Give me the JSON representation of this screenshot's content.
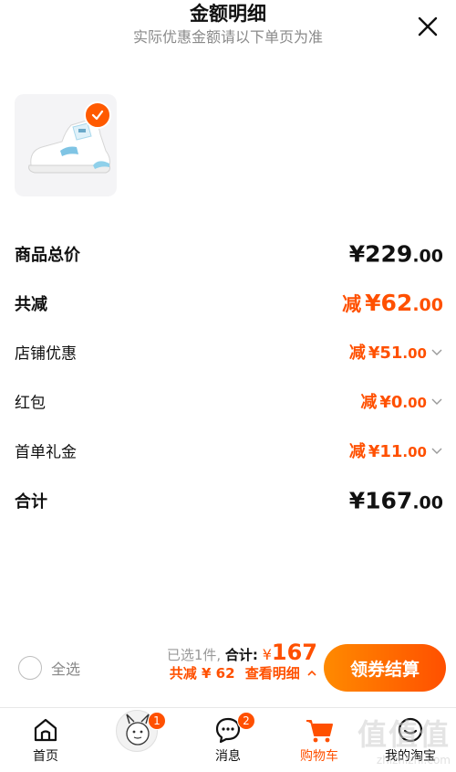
{
  "header": {
    "title": "金额明细",
    "subtitle": "实际优惠金额请以下单页为准"
  },
  "rows": {
    "goods_total": {
      "label": "商品总价",
      "symbol": "¥",
      "int": "229",
      "dec": ".00"
    },
    "total_reduce": {
      "label": "共减",
      "prefix": "减",
      "symbol": "¥",
      "int": "62",
      "dec": ".00"
    },
    "shop_discount": {
      "label": "店铺优惠",
      "prefix": "减",
      "symbol": "¥",
      "int": "51",
      "dec": ".00"
    },
    "red_packet": {
      "label": "红包",
      "prefix": "减",
      "symbol": "¥",
      "int": "0",
      "dec": ".00"
    },
    "first_order_gift": {
      "label": "首单礼金",
      "prefix": "减",
      "symbol": "¥",
      "int": "11",
      "dec": ".00"
    },
    "sum": {
      "label": "合计",
      "symbol": "¥",
      "int": "167",
      "dec": ".00"
    }
  },
  "bottom": {
    "select_all": "全选",
    "selected": "已选1件,",
    "total_label": "合计:",
    "yen": "¥",
    "total_amount": "167",
    "reduce_text": "共减 ¥ 62",
    "detail_link": "查看明细",
    "checkout": "领券结算"
  },
  "tabs": [
    {
      "label": "首页",
      "icon": "home-icon"
    },
    {
      "label": "",
      "icon": "avatar",
      "badge": "1"
    },
    {
      "label": "消息",
      "icon": "message-icon",
      "badge": "2"
    },
    {
      "label": "购物车",
      "icon": "cart-icon"
    },
    {
      "label": "我的淘宝",
      "icon": "profile-icon"
    }
  ],
  "watermark": {
    "logo": "值值值",
    "url": "zhizhizhi.com"
  },
  "colors": {
    "accent": "#ff5000",
    "accent_light": "#ff8a00"
  }
}
